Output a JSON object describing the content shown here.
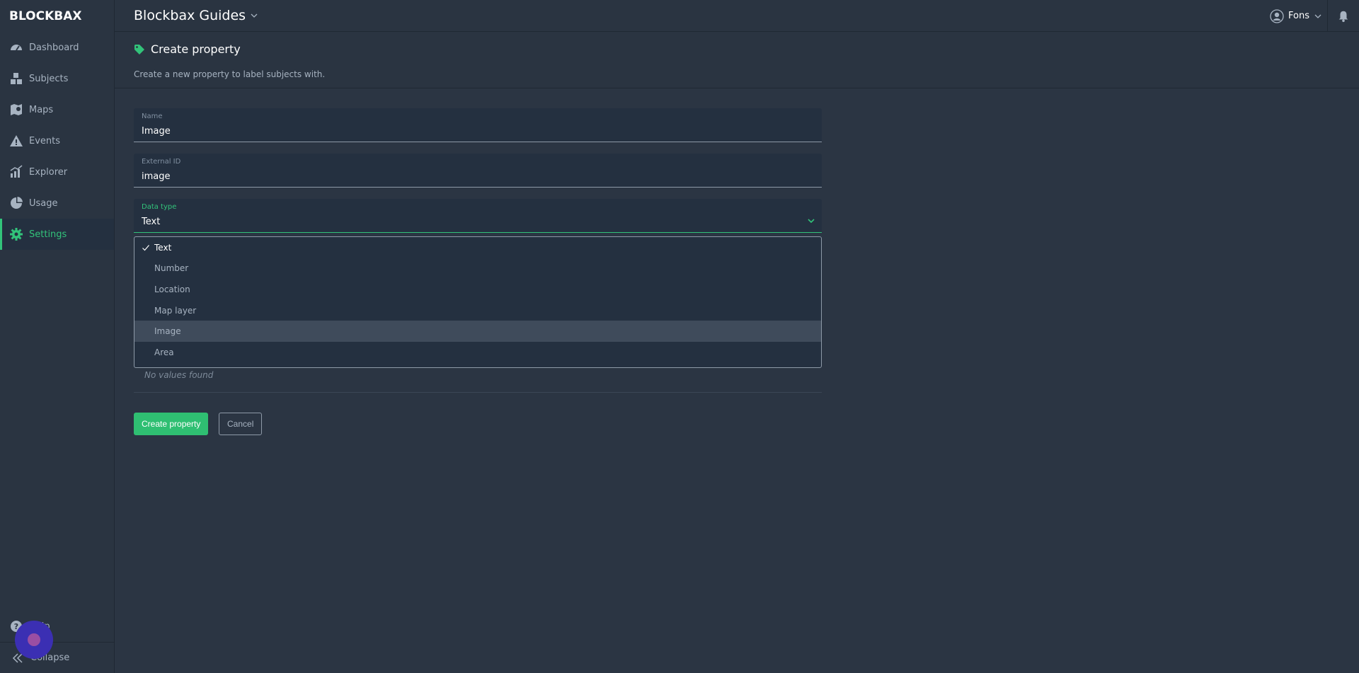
{
  "app": {
    "logo_text": "BLOCKBAX",
    "project_title": "Blockbax Guides"
  },
  "sidebar": {
    "items": [
      {
        "label": "Dashboard",
        "icon": "dashboard-icon"
      },
      {
        "label": "Subjects",
        "icon": "subjects-icon"
      },
      {
        "label": "Maps",
        "icon": "map-icon"
      },
      {
        "label": "Events",
        "icon": "warning-icon"
      },
      {
        "label": "Explorer",
        "icon": "chart-icon"
      },
      {
        "label": "Usage",
        "icon": "pie-chart-icon"
      },
      {
        "label": "Settings",
        "icon": "gear-icon",
        "active": true
      }
    ],
    "help_label": "Help",
    "collapse_label": "Collapse"
  },
  "user": {
    "name": "Fons"
  },
  "page": {
    "title": "Create property",
    "subtitle": "Create a new property to label subjects with."
  },
  "form": {
    "name": {
      "label": "Name",
      "value": "Image"
    },
    "external_id": {
      "label": "External ID",
      "value": "image"
    },
    "data_type": {
      "label": "Data type",
      "value": "Text"
    },
    "data_type_options": [
      "Text",
      "Number",
      "Location",
      "Map layer",
      "Image",
      "Area"
    ],
    "no_values_text": "No values found",
    "submit_label": "Create property",
    "cancel_label": "Cancel"
  },
  "colors": {
    "accent": "#32c37a",
    "background": "#2b3543",
    "sidebar": "#2a3441"
  }
}
